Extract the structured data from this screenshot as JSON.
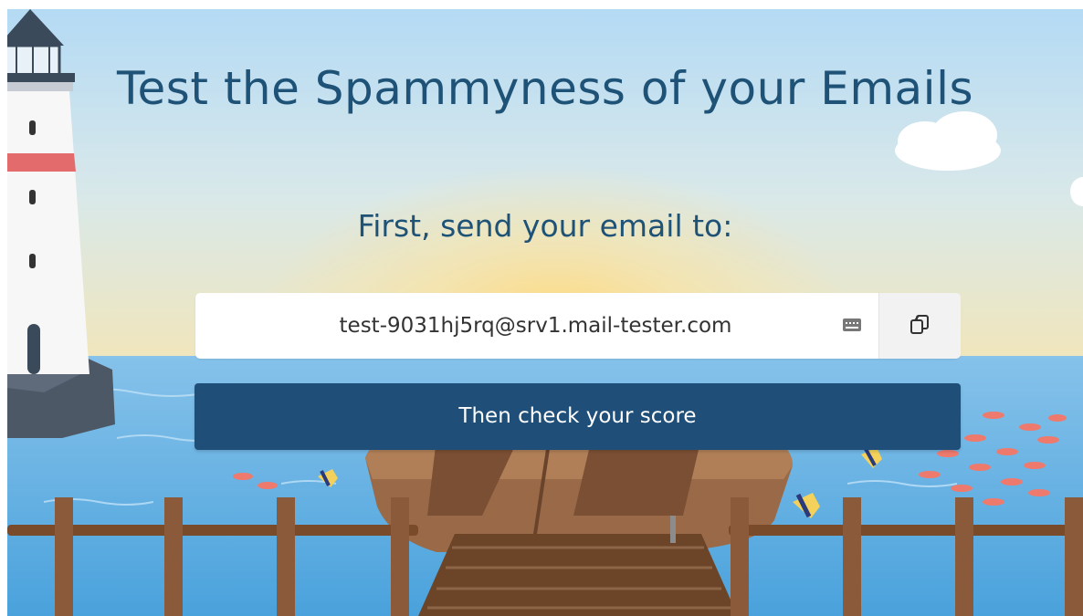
{
  "header": {
    "title": "Test the Spammyness of your Emails"
  },
  "main": {
    "subtitle": "First, send your email to:",
    "email_address": "test-9031hj5rq@srv1.mail-tester.com",
    "keyboard_icon": "keyboard-icon",
    "copy_icon": "copy-icon",
    "check_button_label": "Then check your score"
  },
  "colors": {
    "title": "#1f5277",
    "button_bg": "#1f4f78",
    "button_text": "#ffffff",
    "sky": "#b9dcf2",
    "sea": "#5aaee0",
    "wood": "#8a5a3b"
  }
}
